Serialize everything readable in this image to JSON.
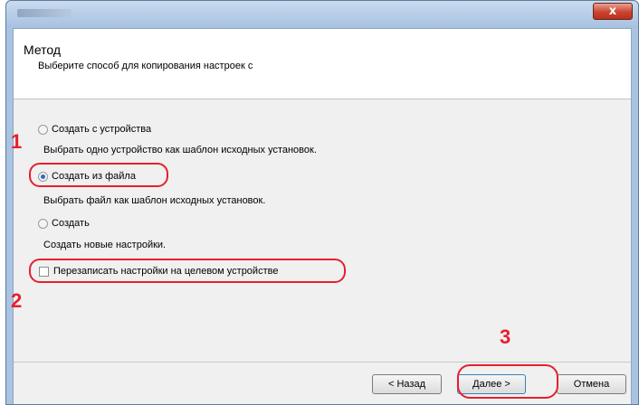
{
  "window": {
    "close_glyph": "x"
  },
  "header": {
    "title": "Метод",
    "subtitle": "Выберите способ для копирования настроек с"
  },
  "options": {
    "from_device": {
      "label": "Создать с устройства",
      "description": "Выбрать одно устройство как шаблон исходных установок.",
      "selected": false
    },
    "from_file": {
      "label": "Создать из файла",
      "description": "Выбрать файл как шаблон исходных установок.",
      "selected": true
    },
    "create_new": {
      "label": "Создать",
      "description": "Создать новые настройки.",
      "selected": false
    }
  },
  "overwrite": {
    "label": "Перезаписать настройки на целевом устройстве",
    "checked": false
  },
  "steps": {
    "one": "1",
    "two": "2",
    "three": "3"
  },
  "buttons": {
    "back": "< Назад",
    "next": "Далее >",
    "cancel": "Отмена"
  },
  "colors": {
    "highlight": "#e5202f",
    "radio_accent": "#2d6bc7"
  }
}
